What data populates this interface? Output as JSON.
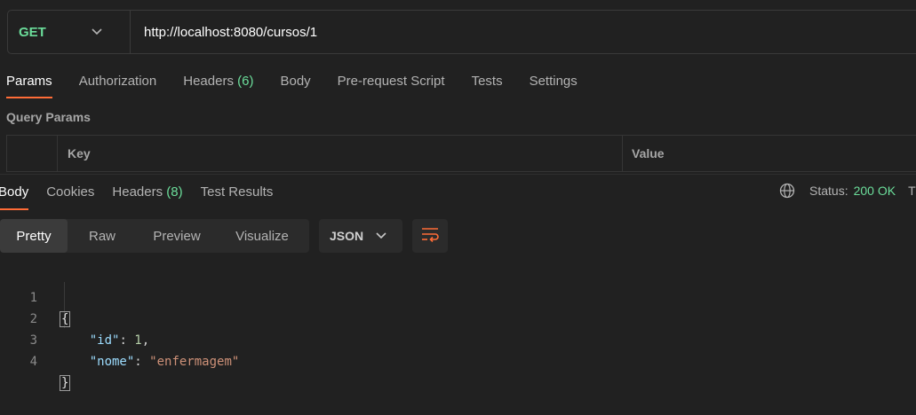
{
  "request": {
    "method": "GET",
    "url": "http://localhost:8080/cursos/1",
    "tabs": [
      {
        "label": "Params"
      },
      {
        "label": "Authorization"
      },
      {
        "label": "Headers",
        "count": "(6)"
      },
      {
        "label": "Body"
      },
      {
        "label": "Pre-request Script"
      },
      {
        "label": "Tests"
      },
      {
        "label": "Settings"
      }
    ],
    "active_tab": "Params"
  },
  "query_params": {
    "title": "Query Params",
    "columns": [
      "Key",
      "Value"
    ]
  },
  "response": {
    "tabs": [
      {
        "label": "Body"
      },
      {
        "label": "Cookies"
      },
      {
        "label": "Headers",
        "count": "(8)"
      },
      {
        "label": "Test Results"
      }
    ],
    "active_tab": "Body",
    "status_label": "Status:",
    "status_value": "200 OK",
    "status_trailing": "T",
    "view_modes": [
      "Pretty",
      "Raw",
      "Preview",
      "Visualize"
    ],
    "active_view": "Pretty",
    "format": "JSON",
    "body_lines": [
      {
        "n": "1",
        "text": "{"
      },
      {
        "n": "2",
        "key": "\"id\"",
        "colon": ": ",
        "value": "1",
        "comma": ","
      },
      {
        "n": "3",
        "key": "\"nome\"",
        "colon": ": ",
        "value": "\"enfermagem\""
      },
      {
        "n": "4",
        "text": "}"
      }
    ]
  },
  "colors": {
    "accent": "#ff6c37",
    "success": "#6bdd9a",
    "background": "#212121"
  },
  "icons": [
    "chevron-down-icon",
    "globe-icon",
    "wrap-lines-icon"
  ]
}
